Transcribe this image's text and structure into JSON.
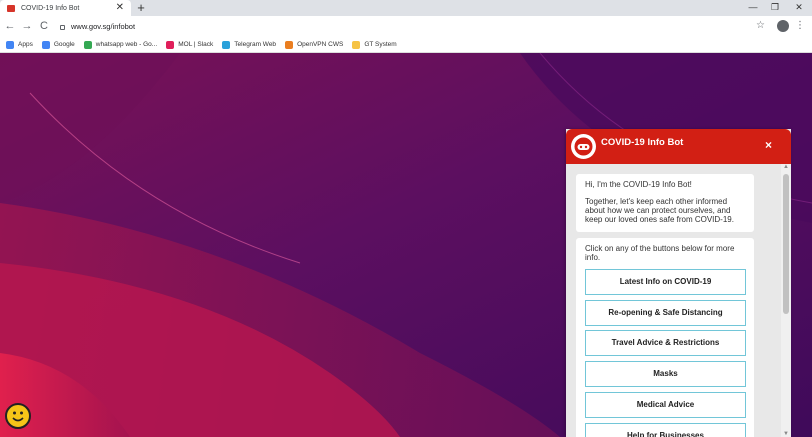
{
  "browser": {
    "tab_title": "COVID-19 Info Bot",
    "tab_close": "✕",
    "new_tab": "+",
    "window_min": "—",
    "window_max": "❐",
    "window_close": "✕",
    "back": "←",
    "forward": "→",
    "reload": "C",
    "url": "www.gov.sg/infobot",
    "star": "☆",
    "menu": "⋮",
    "bookmarks": [
      {
        "label": "Apps",
        "icon": "apps-grid-icon",
        "color": "#4285f4"
      },
      {
        "label": "Google",
        "icon": "google-icon",
        "color": "#4285f4"
      },
      {
        "label": "whatsapp web - Go...",
        "icon": "google-icon",
        "color": "#34a853"
      },
      {
        "label": "MOL | Slack",
        "icon": "slack-icon",
        "color": "#e01e5a"
      },
      {
        "label": "Telegram Web",
        "icon": "telegram-icon",
        "color": "#2aa1da"
      },
      {
        "label": "OpenVPN CWS",
        "icon": "openvpn-icon",
        "color": "#ea7e20"
      },
      {
        "label": "GT System",
        "icon": "folder-icon",
        "color": "#f6c344"
      }
    ]
  },
  "chat": {
    "title": "COVID-19 Info Bot",
    "close": "×",
    "messages": [
      {
        "paragraphs": [
          "Hi, I'm the COVID-19 Info Bot!",
          "Together, let's keep each other informed about how we can protect ourselves, and keep our loved ones safe from COVID-19."
        ]
      },
      {
        "paragraphs": [
          "Click on any of the buttons below for more info."
        ]
      }
    ],
    "options": [
      "Latest Info on COVID-19",
      "Re-opening & Safe Distancing",
      "Travel Advice & Restrictions",
      "Masks",
      "Medical Advice",
      "Help for Businesses"
    ]
  },
  "colors": {
    "header_red": "#d21f14",
    "button_border": "#72c6d8",
    "bg_purple": "#5a0f63",
    "bg_magenta": "#d61b4f"
  }
}
